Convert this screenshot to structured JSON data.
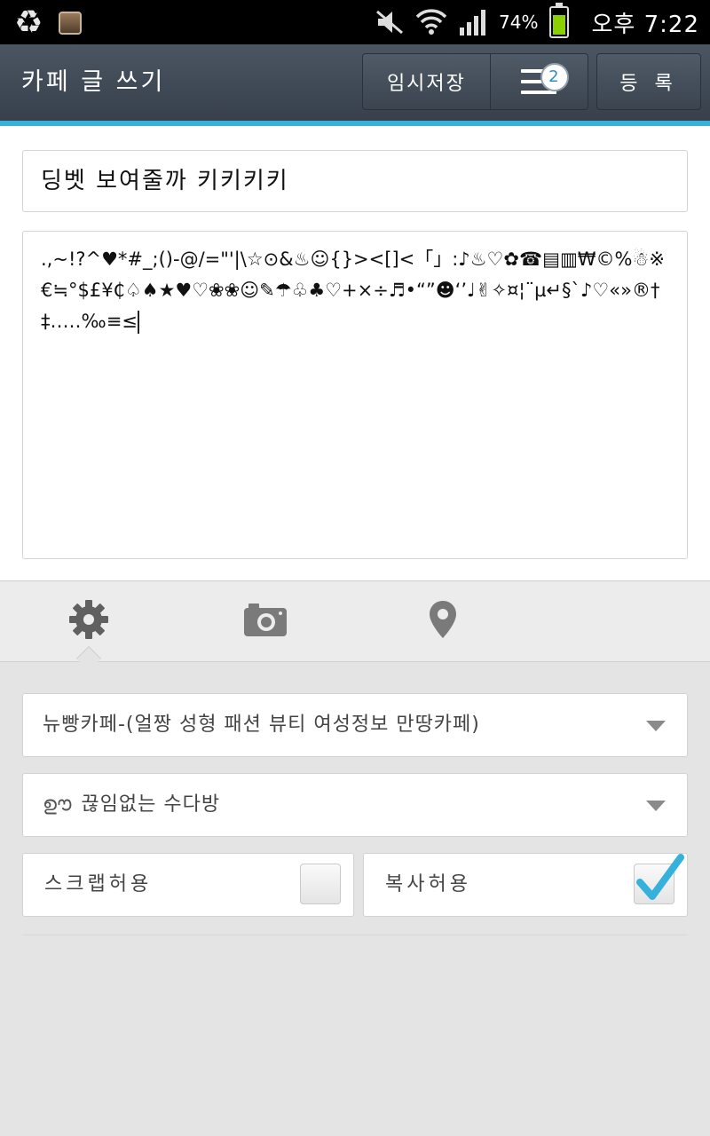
{
  "status_bar": {
    "battery_percent": "74%",
    "battery_level": 0.74,
    "time": "오후 7:22",
    "icons": [
      "recycle-icon",
      "app-thumbnail",
      "mute-icon",
      "wifi-icon",
      "signal-icon",
      "battery-icon"
    ]
  },
  "action_bar": {
    "title": "카페 글 쓰기",
    "temp_save_label": "임시저장",
    "drafts_count": "2",
    "register_label": "등 록"
  },
  "editor": {
    "title_value": "딩벳 보여줄까 키키키키",
    "body_value": ".,~!?^♥*#_;()-@/=\"'|\\☆⊙&♨☺{}><[]<「」:♪♨♡✿☎▤▥₩©%☃※€≒°$£¥₵♤♠★♥♡❀❀☺✎☂♧♣♡+×÷♬•“”☻‘’♩✌✧¤¦¨µ↵§`♪♡«»®†‡‥…‰≡≤"
  },
  "tabs": [
    {
      "name": "settings",
      "icon": "gear-icon",
      "active": true
    },
    {
      "name": "camera",
      "icon": "camera-icon",
      "active": false
    },
    {
      "name": "location",
      "icon": "location-pin-icon",
      "active": false
    }
  ],
  "settings": {
    "cafe_select": "뉴빵카페-(얼짱 성형 패션 뷰티 여성정보 만땅카페)",
    "board_select": "끊임없는 수다방",
    "scrap_label": "스크랩허용",
    "scrap_checked": false,
    "copy_label": "복사허용",
    "copy_checked": true
  },
  "colors": {
    "action_bar": "#404a56",
    "accent": "#35b1dc",
    "battery": "#8bd100"
  }
}
